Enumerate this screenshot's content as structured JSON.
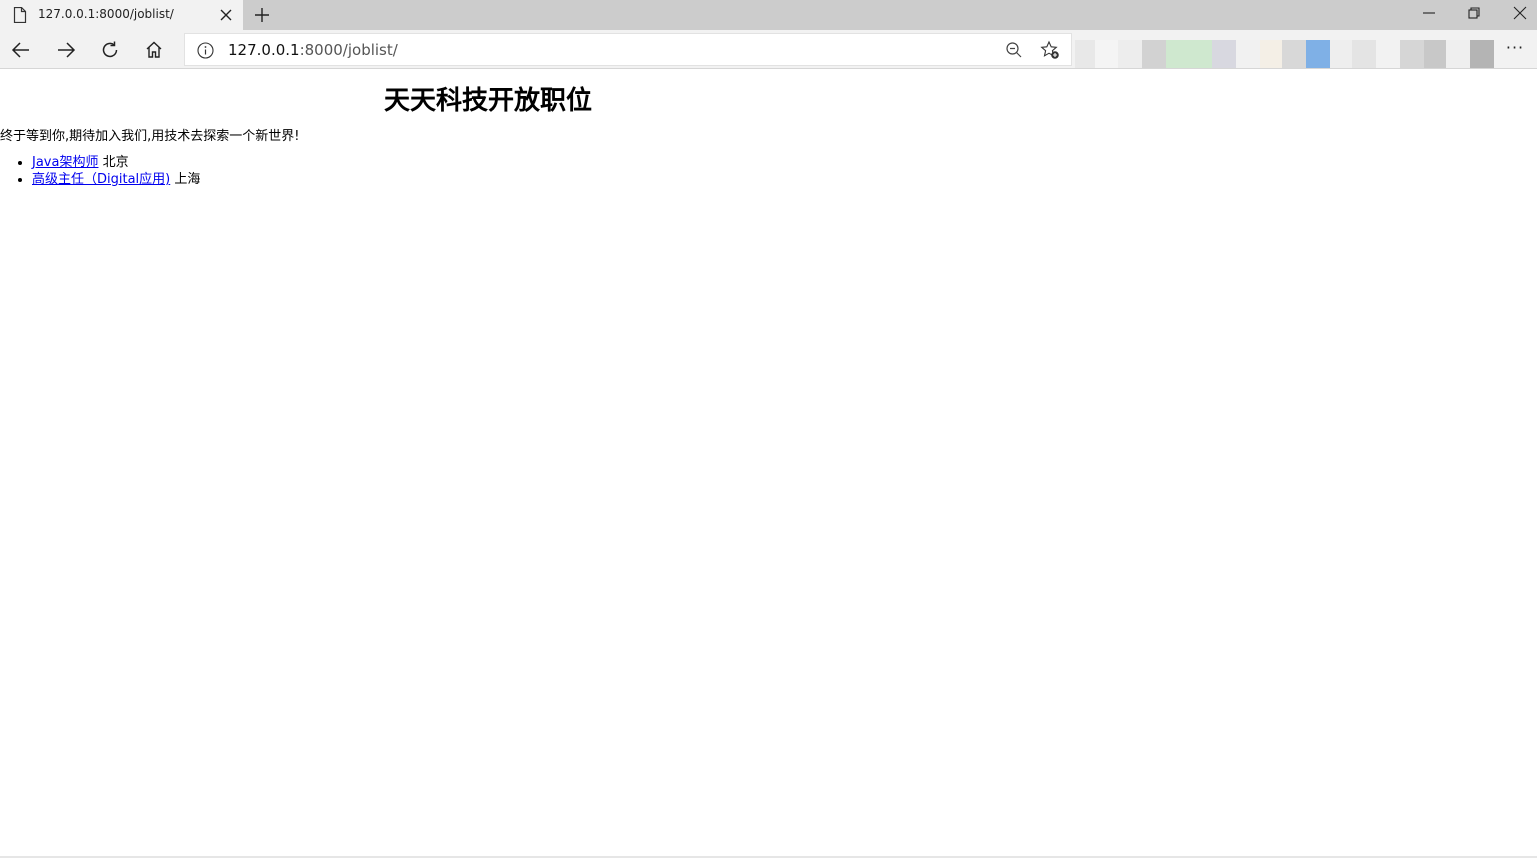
{
  "tab": {
    "title": "127.0.0.1:8000/joblist/",
    "page_icon": "page-icon",
    "close_icon": "close-icon"
  },
  "new_tab_icon": "plus-icon",
  "window_controls": [
    "minimize-icon",
    "restore-icon",
    "close-icon"
  ],
  "toolbar": {
    "back_icon": "arrow-left-icon",
    "forward_icon": "arrow-right-icon",
    "reload_icon": "reload-icon",
    "home_icon": "home-icon",
    "more_label": "···"
  },
  "address": {
    "host": "127.0.0.1",
    "path": ":8000/joblist/",
    "info_icon": "info-icon",
    "zoom_icon": "zoom-out-icon",
    "favorite_icon": "favorite-add-icon"
  },
  "extension_colors": [
    "#e8e8e8",
    "#f4f4f4",
    "#ededed",
    "#d2d2d2",
    "#cfe8cf",
    "#d8d8e0",
    "#f1f1f1",
    "#f4efe6",
    "#d8d8d8",
    "#7fb0e6",
    "#eeeeee",
    "#e4e4e4",
    "#f2f2f2",
    "#d6d6d6",
    "#c8c8c8",
    "#efefef",
    "#b4b4b4"
  ],
  "page": {
    "heading": "天天科技开放职位",
    "intro": "终于等到你,期待加入我们,用技术去探索一个新世界!",
    "jobs": [
      {
        "title": "Java架构师",
        "city": "北京"
      },
      {
        "title": "高级主任（Digital应用)",
        "city": "上海"
      }
    ]
  },
  "colors": {
    "titlebar": "#cccccc",
    "toolbar": "#f2f2f2",
    "link": "#0000ee"
  }
}
